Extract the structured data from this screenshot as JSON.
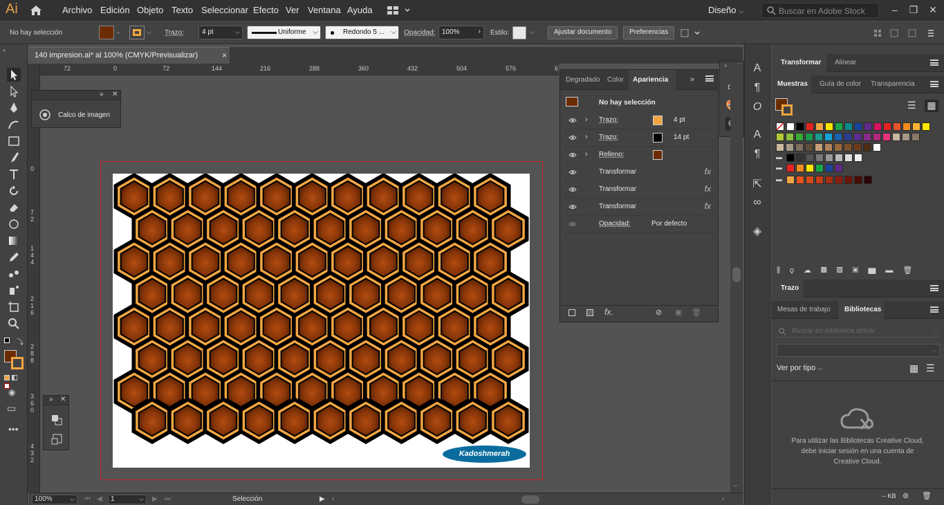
{
  "app": {
    "logo": "Ai"
  },
  "menu": {
    "items": [
      "Archivo",
      "Edición",
      "Objeto",
      "Texto",
      "Seleccionar",
      "Efecto",
      "Ver",
      "Ventana",
      "Ayuda"
    ],
    "workspace": "Diseño",
    "search_placeholder": "Buscar en Adobe Stock"
  },
  "control": {
    "selection": "No hay selección",
    "stroke_label": "Trazo:",
    "stroke_weight": "4 pt",
    "stroke_profile": "Uniforme",
    "brush": "Redondo 5 ...",
    "opacity_label": "Opacidad:",
    "opacity_value": "100%",
    "style_label": "Estilo:",
    "fit_doc_btn": "Ajustar documento",
    "prefs_btn": "Preferencias"
  },
  "document": {
    "tab_title": "140 impresion.ai* al 100% (CMYK/Previsualizar)",
    "close": "×"
  },
  "rulers": {
    "horizontal": [
      "72",
      "0",
      "72",
      "144",
      "216",
      "288",
      "360",
      "432",
      "504",
      "576",
      "6"
    ],
    "vertical": [
      "0",
      "7\n2",
      "1\n4\n4",
      "2\n1\n6",
      "2\n8\n8",
      "3\n6\n0",
      "4\n3\n2"
    ]
  },
  "image_trace_panel": {
    "title": "Calco de imagen"
  },
  "appearance": {
    "tabs": [
      "Degradado",
      "Color",
      "Apariencia"
    ],
    "header": "No hay selección",
    "rows": [
      {
        "label": "Trazo:",
        "value": "4 pt",
        "swatch": "#f2a641",
        "expander": "›",
        "fx": ""
      },
      {
        "label": "Trazo:",
        "value": "14 pt",
        "swatch": "#000000",
        "expander": "›",
        "fx": ""
      },
      {
        "label": "Relleno:",
        "value": "",
        "swatch": "#6b2c04",
        "expander": "›",
        "fx": ""
      },
      {
        "label": "Transformar",
        "value": "",
        "swatch": "",
        "expander": "",
        "fx": "fx"
      },
      {
        "label": "Transformar",
        "value": "",
        "swatch": "",
        "expander": "",
        "fx": "fx"
      },
      {
        "label": "Transformar",
        "value": "",
        "swatch": "",
        "expander": "",
        "fx": "fx"
      },
      {
        "label": "Opacidad:",
        "value": "Por defecto",
        "swatch": "",
        "expander": "",
        "fx": ""
      }
    ]
  },
  "dock": {
    "top_tabs": [
      "Transformar",
      "Alinear"
    ],
    "swatch_tabs": [
      "Muestras",
      "Guía de color",
      "Transparencia"
    ],
    "stroke_tab": "Trazo",
    "lib_tabs": [
      "Mesas de trabajo",
      "Bibliotecas"
    ],
    "lib_search_placeholder": "Buscar en biblioteca actual",
    "view_by": "Ver por tipo",
    "cc_message": "Para utilizar las Bibliotecas Creative Cloud, debe iniciar sesión en una cuenta de Creative Cloud.",
    "kb": "-- KB"
  },
  "swatches": {
    "row1": [
      "#ffffff",
      "#000000",
      "#e52420",
      "#f2a641",
      "#ffe600",
      "#19a64a",
      "#0b8a8a",
      "#1b449c",
      "#622a8c",
      "#d7125f",
      "#e52420",
      "#e9542c",
      "#f08b1e",
      "#f9b233",
      "#ffe600"
    ],
    "row2": [
      "#b4c935",
      "#8cbf3f",
      "#3aa935",
      "#1c9a4c",
      "#1c9b8c",
      "#13a0d3",
      "#1a62ae",
      "#2c3e8f",
      "#5c2d91",
      "#8a2c8c",
      "#ae2a7d",
      "#e5337b",
      "#c8b79d",
      "#a59686",
      "#8a7a68"
    ],
    "row3": [
      "#c9b99f",
      "#a89a88",
      "#7e6d5b",
      "#614f3c",
      "#c8a07a",
      "#b2835a",
      "#98673a",
      "#7b5029",
      "#6b3d1c",
      "#4d2b12",
      "#ffffff"
    ],
    "row4": [
      "#000000",
      "#333333",
      "#555555",
      "#777777",
      "#999999",
      "#bbbbbb",
      "#dddddd",
      "#f2f2f2"
    ],
    "row5": [
      "#e52420",
      "#f08b1e",
      "#ffe600",
      "#19a64a",
      "#1b449c",
      "#622a8c"
    ],
    "row6": [
      "#f2a641",
      "#e6541e",
      "#d44a1c",
      "#c23c18",
      "#a52d14",
      "#8c2010",
      "#6e160c",
      "#4a0c08",
      "#2a0504"
    ]
  },
  "status": {
    "zoom": "100%",
    "page": "1",
    "mode": "Selección"
  },
  "colors": {
    "fill": "#6b2c04",
    "stroke": "#f2a641",
    "hex_edge": "#f2a641",
    "hex_dark": "#5a2304",
    "hex_light": "#a94812",
    "artboard_bleed": "#c62626"
  }
}
